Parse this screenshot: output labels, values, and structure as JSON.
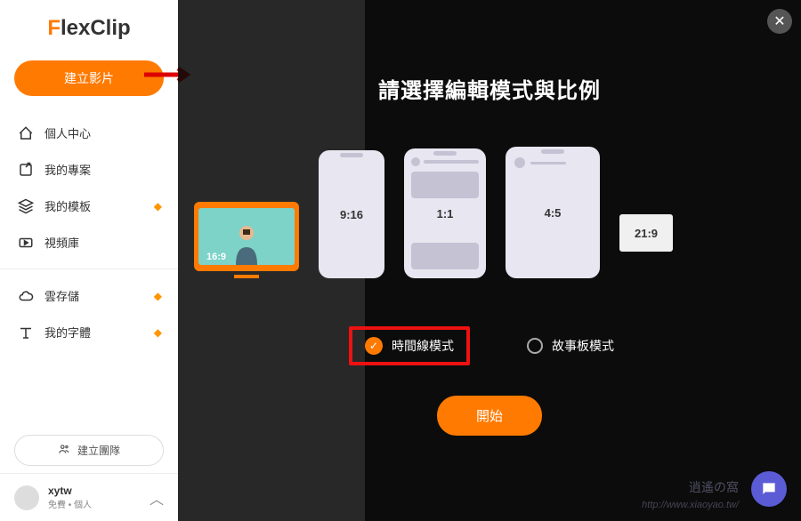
{
  "brand": {
    "name": "FlexClip",
    "f": "F",
    "rest": "lexClip"
  },
  "sidebar": {
    "create_label": "建立影片",
    "items": [
      {
        "label": "個人中心",
        "icon": "home"
      },
      {
        "label": "我的專案",
        "icon": "edit"
      },
      {
        "label": "我的模板",
        "icon": "layers",
        "premium": true
      },
      {
        "label": "視頻庫",
        "icon": "video"
      }
    ],
    "items2": [
      {
        "label": "雲存儲",
        "icon": "cloud",
        "premium": true
      },
      {
        "label": "我的字體",
        "icon": "text",
        "premium": true
      }
    ],
    "team_label": "建立團隊",
    "user": {
      "name": "xytw",
      "plan": "免費 • 個人"
    }
  },
  "modal": {
    "title": "請選擇編輯模式與比例",
    "ratios": [
      {
        "label": "16:9",
        "shape": "monitor",
        "selected": true
      },
      {
        "label": "9:16",
        "shape": "phone-916"
      },
      {
        "label": "1:1",
        "shape": "phone-11"
      },
      {
        "label": "4:5",
        "shape": "phone-45"
      },
      {
        "label": "21:9",
        "shape": "phone-219"
      }
    ],
    "modes": [
      {
        "label": "時間線模式",
        "selected": true
      },
      {
        "label": "故事板模式",
        "selected": false
      }
    ],
    "start_label": "開始"
  },
  "watermark": {
    "url": "http://www.xiaoyao.tw/",
    "name": "逍遙の窩"
  }
}
